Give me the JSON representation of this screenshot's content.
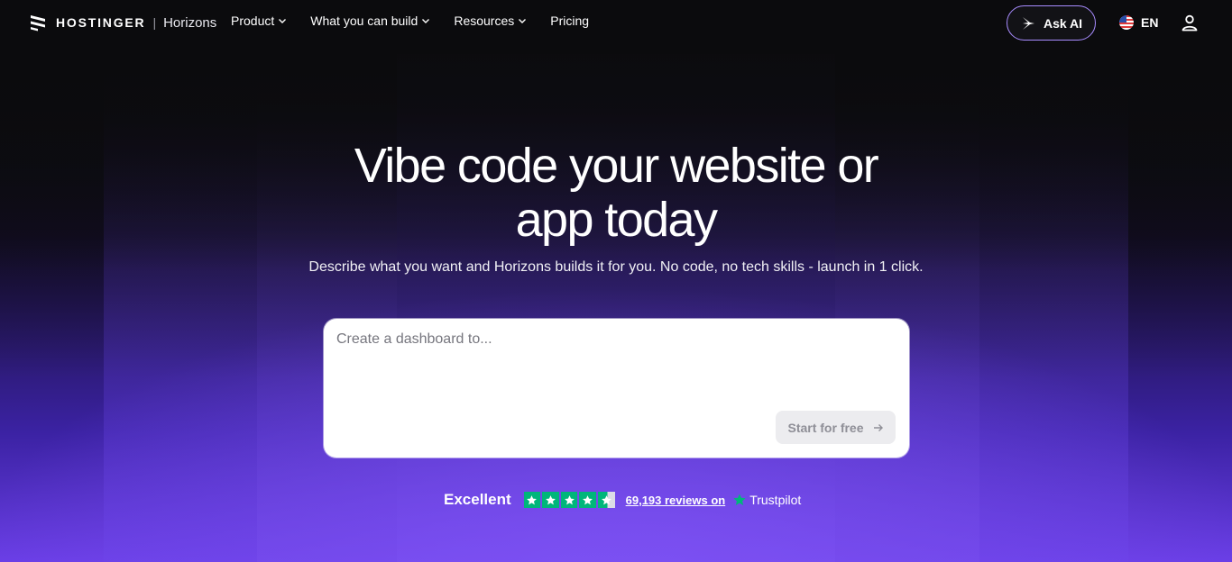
{
  "colors": {
    "accent": "#7b4cf0",
    "ask_ai_border": "#a88cff",
    "trustpilot_green": "#00b67a"
  },
  "nav": {
    "brand": "HOSTINGER",
    "separator": "|",
    "product": "Horizons",
    "menu": [
      {
        "label": "Product",
        "icon": "chevron-down-icon"
      },
      {
        "label": "What you can build",
        "icon": "chevron-down-icon"
      },
      {
        "label": "Resources",
        "icon": "chevron-down-icon"
      },
      {
        "label": "Pricing"
      }
    ],
    "ask_ai": "Ask AI",
    "language": "EN"
  },
  "hero": {
    "headline_line1": "Vibe code your website or",
    "headline_line2": "app today",
    "subheadline": "Describe what you want and Horizons builds it for you. No code, no tech skills - launch in 1 click."
  },
  "prompt": {
    "placeholder": "Create a dashboard to...",
    "value": "",
    "button_label": "Start for free"
  },
  "trustpilot": {
    "rating_label": "Excellent",
    "stars": 4.5,
    "reviews_text": "69,193 reviews on",
    "name": "Trustpilot"
  }
}
